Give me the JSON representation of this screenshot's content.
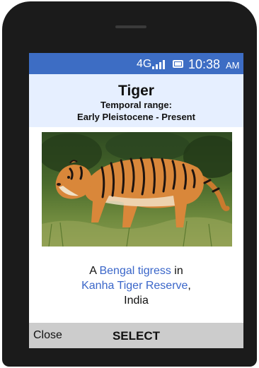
{
  "status": {
    "network": "4G",
    "time": "10:38",
    "ampm": "AM"
  },
  "header": {
    "title": "Tiger",
    "range_label": "Temporal range:",
    "range_value": "Early Pleistocene - Present"
  },
  "image": {
    "alt": "Bengal tigress walking in grass"
  },
  "caption": {
    "prefix": "A ",
    "link1": "Bengal tigress",
    "middle": " in",
    "link2": "Kanha Tiger Reserve",
    "suffix": ",",
    "line3": "India"
  },
  "softkeys": {
    "left": "Close",
    "center": "SELECT"
  },
  "colors": {
    "statusbar": "#3d6dc4",
    "header_bg": "#e6efff",
    "link": "#3a66c9",
    "softkey_bg": "#cccccc"
  }
}
